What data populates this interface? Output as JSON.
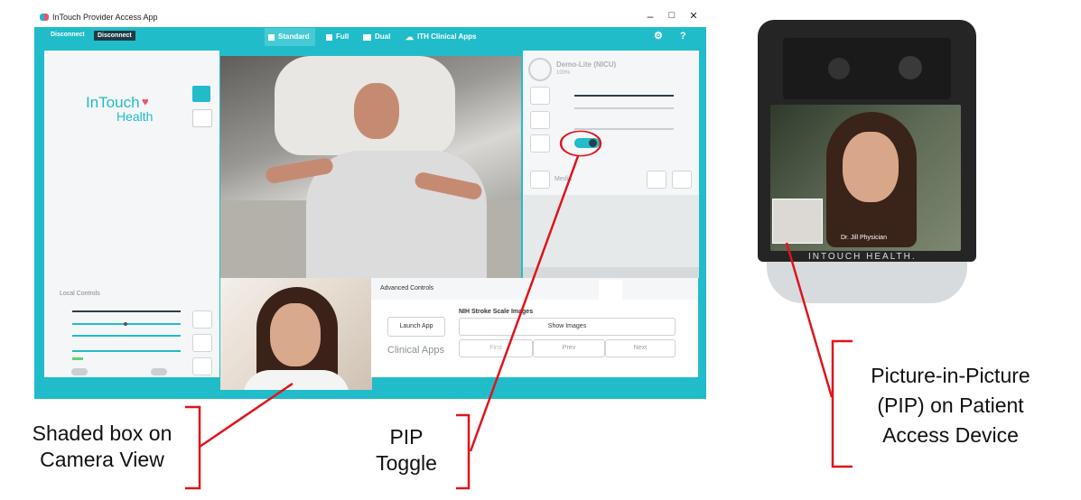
{
  "window": {
    "title": "InTouch Provider Access App",
    "controls": {
      "minimize": "–",
      "maximize": "□",
      "close": "✕"
    }
  },
  "toolbar": {
    "disconnect_text": "Disconnect",
    "disconnect_button": "Disconnect",
    "modes": [
      "Standard",
      "Full",
      "Dual",
      "ITH Clinical Apps"
    ],
    "active_mode": "Standard",
    "settings_icon": "gear-icon",
    "help_label": "?"
  },
  "left_panel": {
    "logo_line1": "InTouch",
    "logo_line2": "Health"
  },
  "right_panel": {
    "device_name": "Demo-Lite (NICU)",
    "device_status": "100%",
    "media_label": "Media",
    "pip_toggle_on": true
  },
  "local_controls": {
    "title": "Local Controls"
  },
  "advanced": {
    "title": "Advanced Controls",
    "launch_app": "Launch App",
    "clinical_apps": "Clinical Apps",
    "nih_title": "NIH Stroke Scale Images",
    "show_images": "Show Images",
    "first": "First",
    "prev": "Prev",
    "next": "Next"
  },
  "device": {
    "name_tag": "Dr. Jill Physician",
    "brand": "INTOUCH HEALTH."
  },
  "annotations": {
    "shaded_box": [
      "Shaded box on",
      "Camera View"
    ],
    "pip_toggle": [
      "PIP",
      "Toggle"
    ],
    "pip_device": [
      "Picture-in-Picture",
      "(PIP) on Patient",
      "Access Device"
    ]
  },
  "colors": {
    "brand_teal": "#21bcc9",
    "annotation_red": "#e0141b",
    "heart_pink": "#e8546d"
  }
}
